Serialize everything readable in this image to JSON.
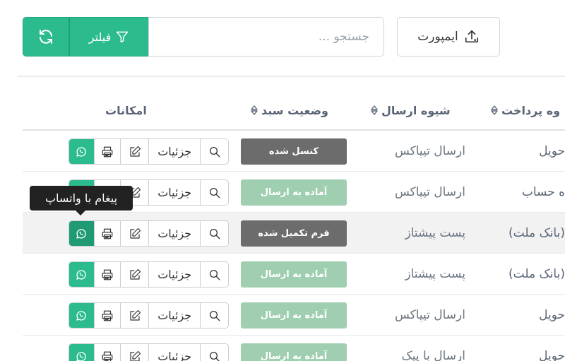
{
  "toolbar": {
    "refresh_icon": "refresh-icon",
    "filter_label": "فیلتر",
    "filter_icon": "funnel-icon",
    "search_placeholder": "جستجو ...",
    "import_label": "ایمپورت",
    "import_icon": "upload-icon"
  },
  "table": {
    "headers": {
      "payment": "وه پرداخت",
      "shipping": "شیوه ارسال",
      "cart_status": "وضعیت سبد",
      "actions": "امکانات"
    },
    "rows": [
      {
        "payment": "حویل",
        "shipping": "ارسال تیپاکس",
        "status": "کنسل شده",
        "status_color": "#6c6c6c"
      },
      {
        "payment": "ه حساب",
        "shipping": "ارسال تیپاکس",
        "status": "آماده به ارسال",
        "status_color": "#9fcfb0"
      },
      {
        "payment": "(بانک ملت)",
        "shipping": "پست پیشتاز",
        "status": "فرم تکمیل شده",
        "status_color": "#6c6c6c"
      },
      {
        "payment": "(بانک ملت)",
        "shipping": "پست پیشتاز",
        "status": "آماده به ارسال",
        "status_color": "#9fcfb0"
      },
      {
        "payment": "حویل",
        "shipping": "ارسال تیپاکس",
        "status": "آماده به ارسال",
        "status_color": "#9fcfb0"
      },
      {
        "payment": "حویل",
        "shipping": "ارسال با پیک",
        "status": "آماده به ارسال",
        "status_color": "#9fcfb0"
      }
    ],
    "action_labels": {
      "details": "جزئیات"
    }
  },
  "tooltip": {
    "text": "پیغام با واتساپ"
  },
  "colors": {
    "accent": "#2bbb8f",
    "badge_gray": "#6c6c6c",
    "badge_green": "#9fcfb0"
  }
}
